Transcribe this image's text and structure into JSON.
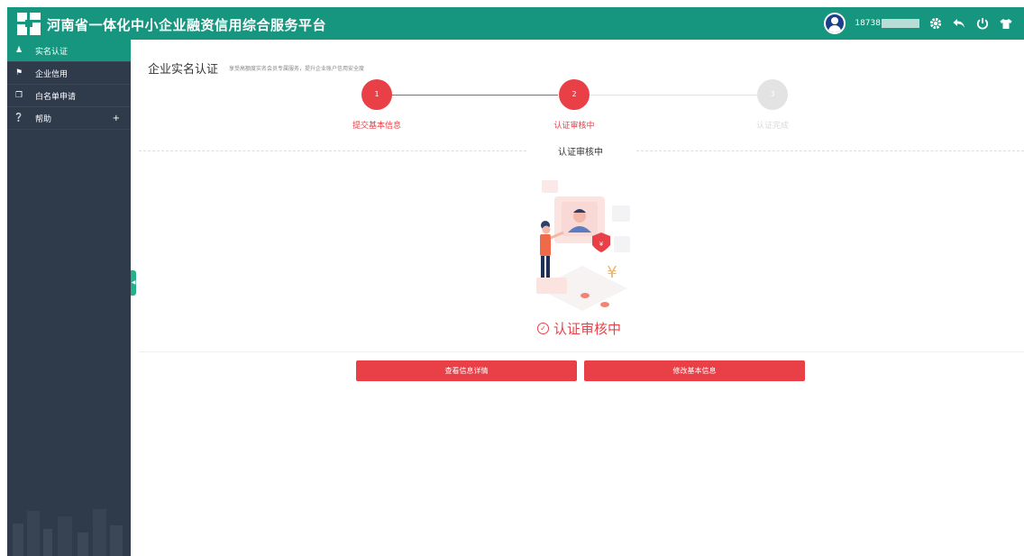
{
  "header": {
    "brand": "河南省一体化中小企业融资信用综合服务平台",
    "user_id": "18738",
    "icons": [
      "user-avatar-icon",
      "gear-icon",
      "back-arrow-icon",
      "power-icon",
      "shirt-icon"
    ]
  },
  "sidebar": {
    "items": [
      {
        "label": "实名认证",
        "icon": "user-icon",
        "active": true
      },
      {
        "label": "企业信用",
        "icon": "bookmark-icon",
        "active": false
      },
      {
        "label": "白名单申请",
        "icon": "copy-icon",
        "active": false
      },
      {
        "label": "帮助",
        "icon": "help-icon",
        "active": false,
        "expand": "+"
      }
    ]
  },
  "page": {
    "title": "企业实名认证",
    "subtitle": "享受高额度实名会员专属服务，提升企业账户信用安全度"
  },
  "steps": [
    {
      "num": "1",
      "label": "提交基本信息",
      "state": "done"
    },
    {
      "num": "2",
      "label": "认证审核中",
      "state": "current"
    },
    {
      "num": "3",
      "label": "认证完成",
      "state": "pending"
    }
  ],
  "section_label": "认证审核中",
  "status_text": "认证审核中",
  "buttons": {
    "view_details": "查看信息详情",
    "modify_info": "修改基本信息"
  },
  "colors": {
    "header_bg": "#16967f",
    "sidebar_bg": "#2f3b4a",
    "accent_red": "#e94047",
    "pending_gray": "#e3e3e3"
  }
}
